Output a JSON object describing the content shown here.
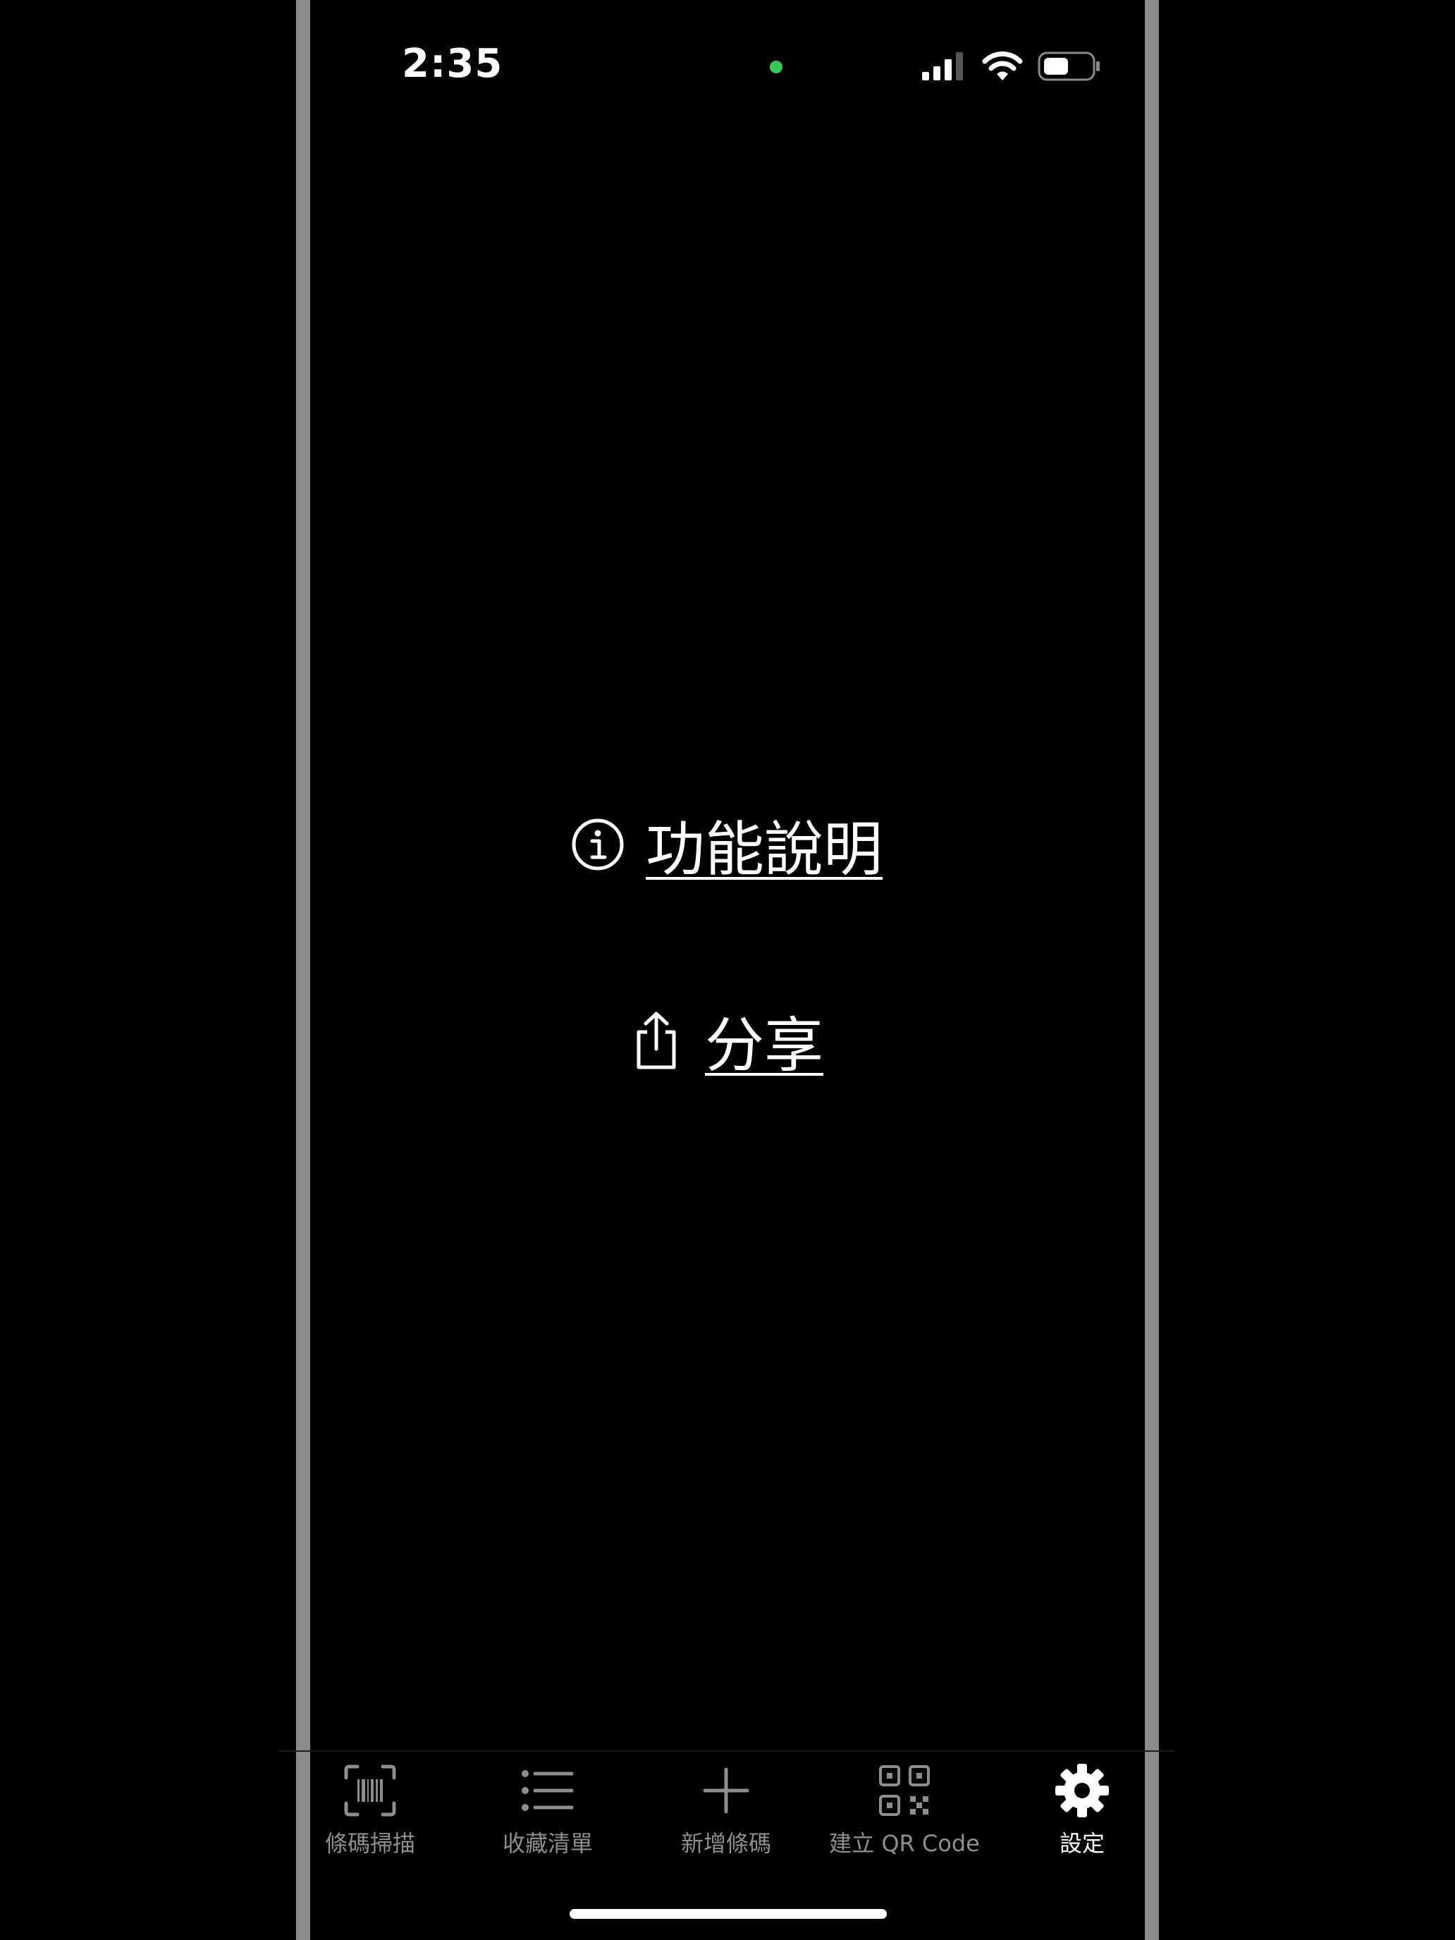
{
  "status_bar": {
    "time": "2:35"
  },
  "menu": {
    "help_label": "功能說明",
    "share_label": "分享"
  },
  "tab_bar": {
    "tabs": [
      {
        "label": "條碼掃描",
        "icon": "barcode-scan-icon",
        "active": false
      },
      {
        "label": "收藏清單",
        "icon": "list-icon",
        "active": false
      },
      {
        "label": "新增條碼",
        "icon": "plus-icon",
        "active": false
      },
      {
        "label": "建立 QR Code",
        "icon": "qrcode-icon",
        "active": false
      },
      {
        "label": "設定",
        "icon": "gear-icon",
        "active": true
      }
    ]
  },
  "colors": {
    "background": "#000000",
    "text": "#ffffff",
    "inactive_tab": "#8e8e8e",
    "recording_dot": "#34c759",
    "side_bar": "#8a8a8a"
  }
}
